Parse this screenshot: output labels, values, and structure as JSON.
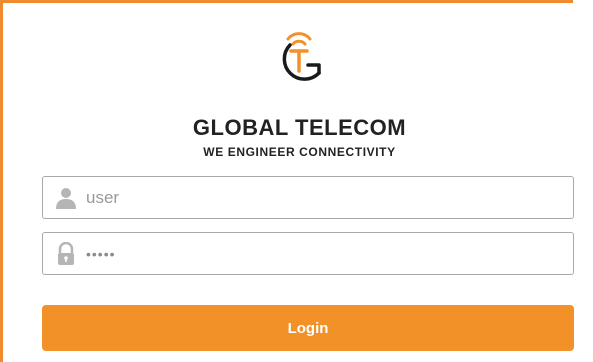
{
  "brand": {
    "name": "GLOBAL TELECOM",
    "tagline": "WE ENGINEER CONNECTIVITY",
    "accent_color": "#f29128",
    "logo_icon": "global-telecom-logo"
  },
  "form": {
    "username": {
      "placeholder": "user",
      "value": "",
      "icon": "user-icon"
    },
    "password": {
      "value": "•••••",
      "icon": "padlock-icon"
    },
    "submit_label": "Login"
  }
}
